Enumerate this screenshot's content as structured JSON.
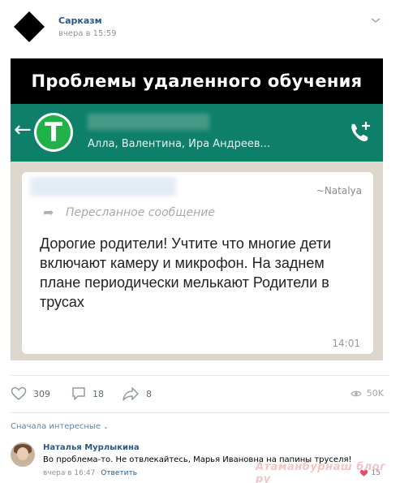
{
  "post": {
    "group_name": "Сарказм",
    "time": "вчера в 15:59",
    "options_icon": "chevron-down-icon"
  },
  "image": {
    "title": "Проблемы удаленного обучения",
    "chat": {
      "members": "Алла, Валентина, Ира Андреев...",
      "logo_letter": "T",
      "sender": "~Natalya",
      "forwarded": "Пересланное сообщение",
      "message": "Дорогие родители! Учтите что многие дети включают камеру и микрофон. На заднем плане периодически мелькают Родители в трусах",
      "time": "14:01"
    },
    "colors": {
      "header_bg": "#0e806a",
      "chat_bg": "#ddd6cc"
    }
  },
  "actions": {
    "likes": "309",
    "comments": "18",
    "shares": "8",
    "views": "50K"
  },
  "comments": {
    "sort_label": "Сначала интересные",
    "items": [
      {
        "author": "Наталья Мурлыкина",
        "text": "Во проблема-то. Не отвлекайтесь, Марья Ивановна на папины труселя!",
        "time": "вчера в 16:47",
        "reply_label": "Ответить",
        "likes": "15"
      }
    ]
  },
  "watermark": "Атаманбурнаш блог ру"
}
